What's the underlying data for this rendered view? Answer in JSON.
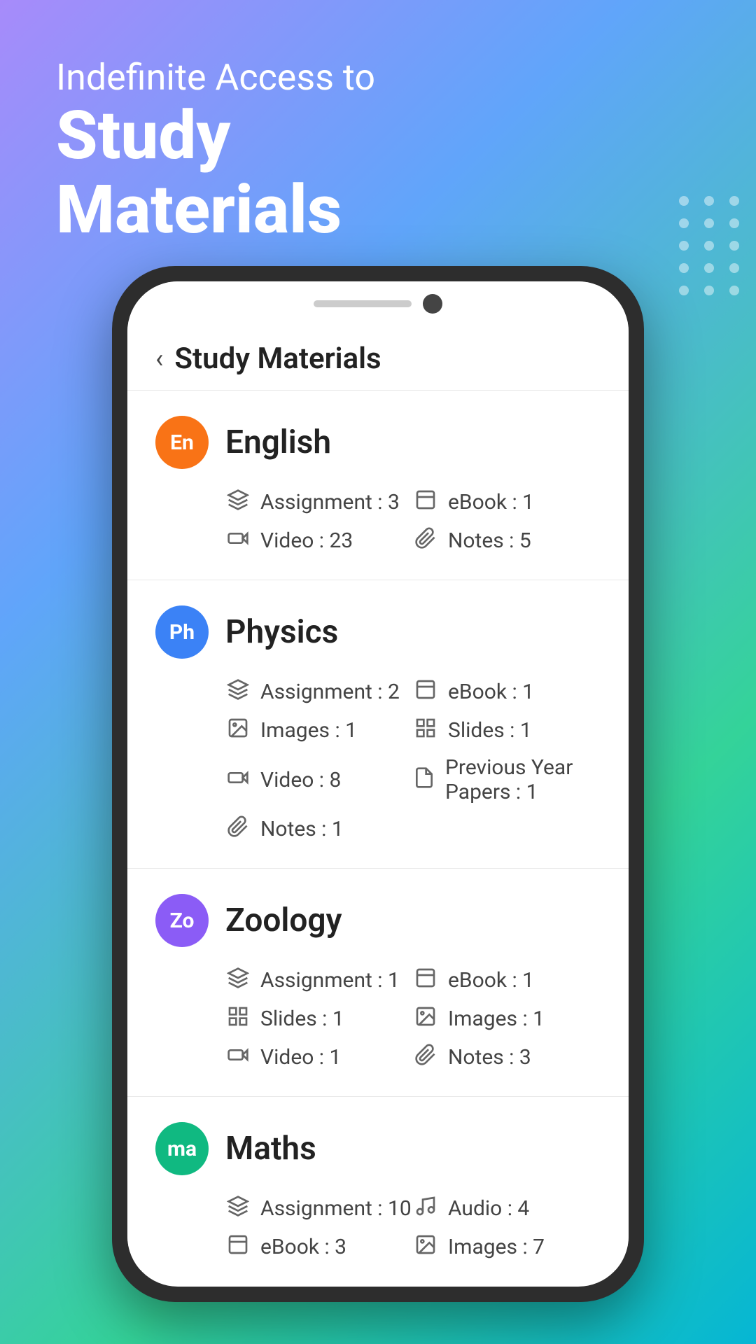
{
  "hero": {
    "subtitle": "Indefinite Access to",
    "title_line1": "Study",
    "title_line2": "Materials"
  },
  "app": {
    "back_label": "‹",
    "header_title": "Study Materials"
  },
  "subjects": [
    {
      "id": "english",
      "name": "English",
      "avatar_text": "En",
      "avatar_color": "avatar-orange",
      "stats": [
        {
          "icon": "layers",
          "label": "Assignment : 3"
        },
        {
          "icon": "book",
          "label": "eBook : 1"
        },
        {
          "icon": "video",
          "label": "Video : 23"
        },
        {
          "icon": "paperclip",
          "label": "Notes : 5"
        }
      ]
    },
    {
      "id": "physics",
      "name": "Physics",
      "avatar_text": "Ph",
      "avatar_color": "avatar-blue",
      "stats": [
        {
          "icon": "layers",
          "label": "Assignment : 2"
        },
        {
          "icon": "book",
          "label": "eBook : 1"
        },
        {
          "icon": "image",
          "label": "Images : 1"
        },
        {
          "icon": "grid",
          "label": "Slides : 1"
        },
        {
          "icon": "video",
          "label": "Video : 8"
        },
        {
          "icon": "file",
          "label": "Previous Year Papers : 1"
        },
        {
          "icon": "paperclip",
          "label": "Notes : 1"
        }
      ]
    },
    {
      "id": "zoology",
      "name": "Zoology",
      "avatar_text": "Zo",
      "avatar_color": "avatar-purple",
      "stats": [
        {
          "icon": "layers",
          "label": "Assignment : 1"
        },
        {
          "icon": "book",
          "label": "eBook : 1"
        },
        {
          "icon": "grid",
          "label": "Slides : 1"
        },
        {
          "icon": "image",
          "label": "Images : 1"
        },
        {
          "icon": "video",
          "label": "Video : 1"
        },
        {
          "icon": "paperclip",
          "label": "Notes : 3"
        }
      ]
    },
    {
      "id": "maths",
      "name": "Maths",
      "avatar_text": "ma",
      "avatar_color": "avatar-green",
      "stats": [
        {
          "icon": "layers",
          "label": "Assignment : 10"
        },
        {
          "icon": "music",
          "label": "Audio : 4"
        },
        {
          "icon": "book",
          "label": "eBook : 3"
        },
        {
          "icon": "image",
          "label": "Images : 7"
        }
      ]
    }
  ]
}
